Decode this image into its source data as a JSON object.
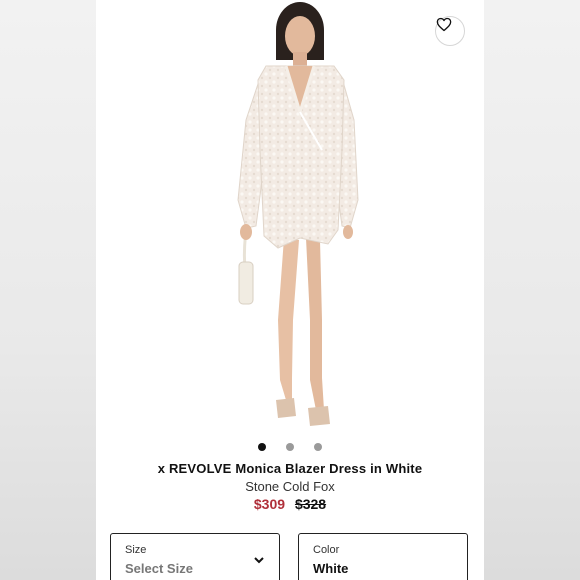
{
  "product": {
    "title": "x REVOLVE Monica Blazer Dress in White",
    "brand": "Stone Cold Fox",
    "sale_price": "$309",
    "original_price": "$328"
  },
  "gallery": {
    "image_count": 3,
    "active_index": 0
  },
  "selectors": {
    "size": {
      "label": "Size",
      "value": "Select Size"
    },
    "color": {
      "label": "Color",
      "value": "White"
    }
  },
  "icons": {
    "wishlist": "heart-icon",
    "size_dropdown": "chevron-down-icon"
  },
  "colors": {
    "sale_price": "#b0303a",
    "text": "#111111",
    "muted_text": "#777777"
  }
}
